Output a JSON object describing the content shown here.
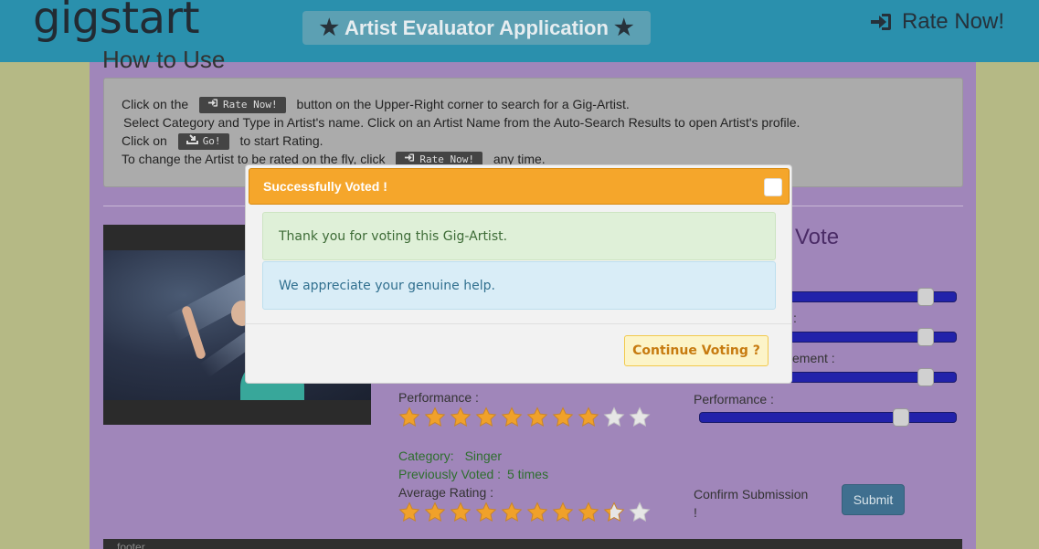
{
  "header": {
    "brand": "gigstart",
    "app_title": "Artist Evaluator Application",
    "rate_now": "Rate Now!"
  },
  "howto": {
    "title": "How to Use",
    "line1_pre": "Click on the",
    "line1_btn": "Rate Now!",
    "line1_post": "button on the Upper-Right corner to search for a Gig-Artist.",
    "line2": "Select Category and Type in Artist's name. Click on an Artist Name from the Auto-Search Results to open Artist's profile.",
    "line3_pre": "Click on",
    "line3_btn": "Go!",
    "line3_post": "to start Rating.",
    "line4_pre": "To change the Artist to be rated on the fly, click",
    "line4_btn": "Rate Now!",
    "line4_post": "any time."
  },
  "artist": {
    "performance_label": "Performance :",
    "performance_stars": 8,
    "category_label": "Category:",
    "category_value": "Singer",
    "voted_label": "Previously Voted :",
    "voted_value": "5 times",
    "average_label": "Average Rating :",
    "average_stars": 8.3,
    "star_max": 10
  },
  "vote": {
    "heading_partial": "Vote",
    "label_partial_2": ":",
    "label_partial_3": "ement :",
    "performance_label": "Performance :",
    "slider_levels": [
      0.9,
      0.9,
      0.9,
      0.8
    ],
    "confirm_label": "Confirm Submission",
    "confirm_mark": "!",
    "submit": "Submit"
  },
  "footer": {
    "text": "footer"
  },
  "modal": {
    "title": "Successfully Voted !",
    "success_text": "Thank you for voting this Gig-Artist.",
    "info_text": "We appreciate your genuine help.",
    "continue_label": "Continue Voting ?"
  },
  "colors": {
    "header_bg": "#2a90ad",
    "page_bg": "#b5b985",
    "content_bg": "#a086ba",
    "modal_header": "#f5a62b",
    "star_fill": "#f0a12a",
    "slider_track": "#2222aa"
  }
}
